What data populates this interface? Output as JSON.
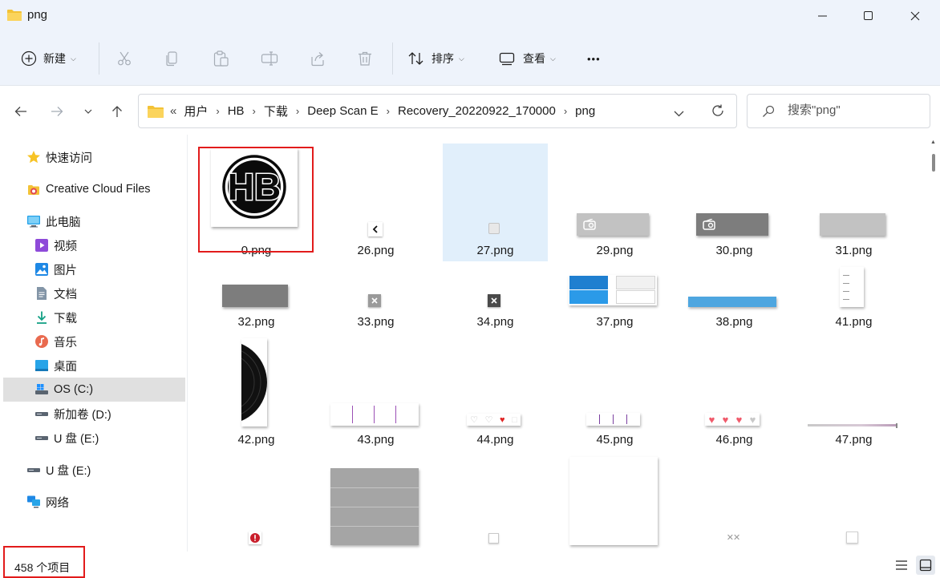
{
  "window": {
    "title": "png"
  },
  "toolbar": {
    "new_label": "新建",
    "sort_label": "排序",
    "view_label": "查看",
    "more_label": "•••"
  },
  "address": {
    "overflow": "«",
    "crumbs": [
      "用户",
      "HB",
      "下载",
      "Deep Scan E",
      "Recovery_20220922_170000",
      "png"
    ]
  },
  "search": {
    "placeholder": "搜索\"png\""
  },
  "sidebar": {
    "quick_access": "快速访问",
    "creative_cloud": "Creative Cloud Files",
    "this_pc": "此电脑",
    "videos": "视频",
    "pictures": "图片",
    "documents": "文档",
    "downloads": "下载",
    "music": "音乐",
    "desktop": "桌面",
    "os_c": "OS (C:)",
    "new_vol_d": "新加卷 (D:)",
    "u_e_1": "U 盘 (E:)",
    "u_e_2": "U 盘 (E:)",
    "network": "网络"
  },
  "files": [
    {
      "name": "0.png"
    },
    {
      "name": "26.png"
    },
    {
      "name": "27.png"
    },
    {
      "name": "29.png"
    },
    {
      "name": "30.png"
    },
    {
      "name": "31.png"
    },
    {
      "name": "32.png"
    },
    {
      "name": "33.png"
    },
    {
      "name": "34.png"
    },
    {
      "name": "37.png"
    },
    {
      "name": "38.png"
    },
    {
      "name": "41.png"
    },
    {
      "name": "42.png"
    },
    {
      "name": "43.png"
    },
    {
      "name": "44.png"
    },
    {
      "name": "45.png"
    },
    {
      "name": "46.png"
    },
    {
      "name": "47.png"
    }
  ],
  "logo_text": "HB",
  "status": {
    "count": "458 个项目"
  },
  "colors": {
    "accent": "#0067c0",
    "highlight_box": "#e21b1b",
    "selection": "#e1effb"
  }
}
